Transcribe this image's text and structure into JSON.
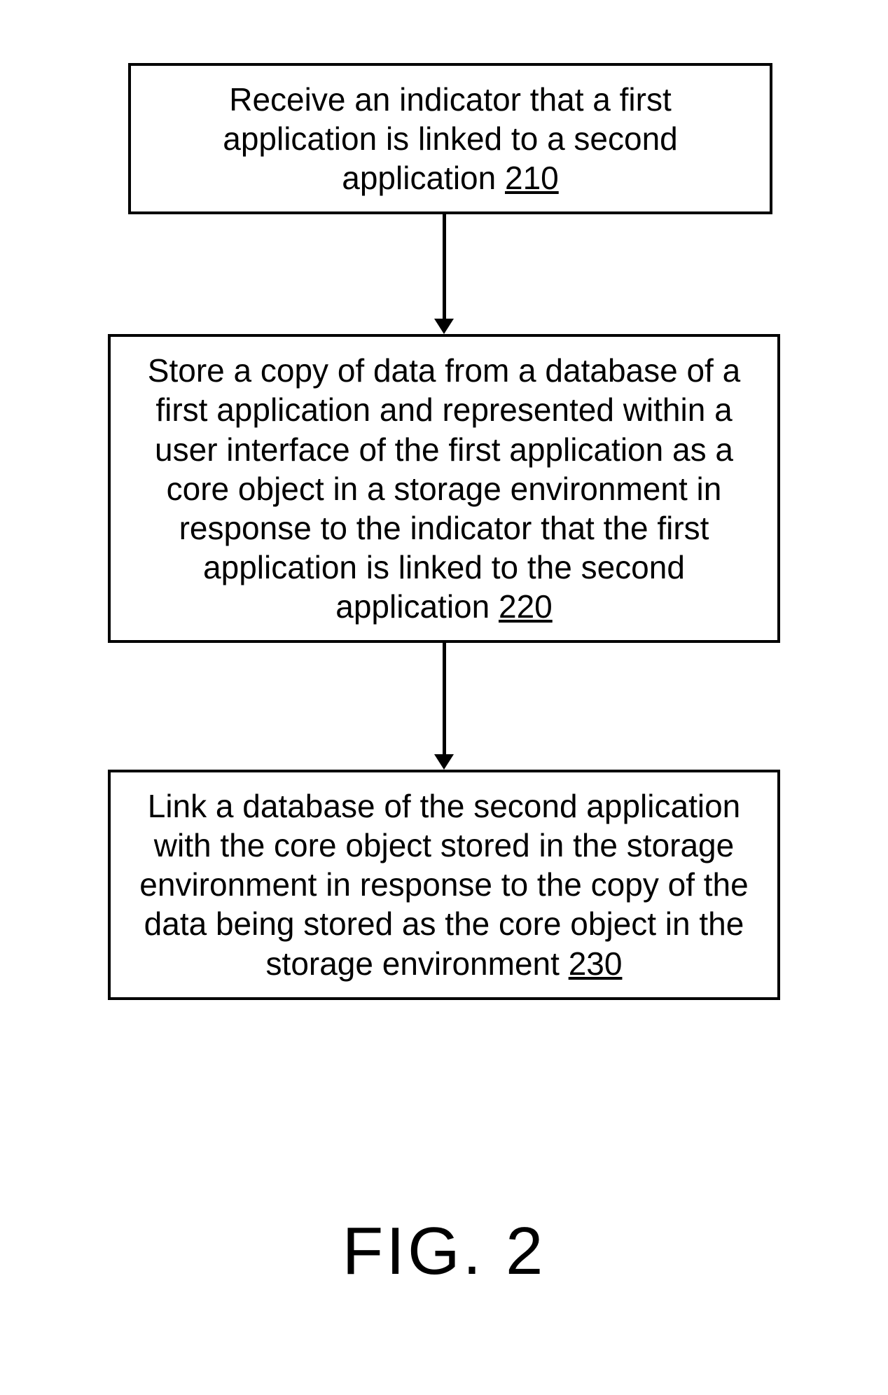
{
  "diagram": {
    "steps": [
      {
        "text": "Receive an indicator that a first application is linked to a second application",
        "ref": "210"
      },
      {
        "text": "Store a copy of data from a database of a first application and represented within a user interface of the first application as a core object in a storage environment in response to the indicator that the first application is linked to the second application",
        "ref": "220"
      },
      {
        "text": "Link a database of the second application with the core object stored in the storage environment in response to the copy of the data being stored as the core object in the storage environment",
        "ref": "230"
      }
    ],
    "figure_label": "FIG. 2"
  }
}
